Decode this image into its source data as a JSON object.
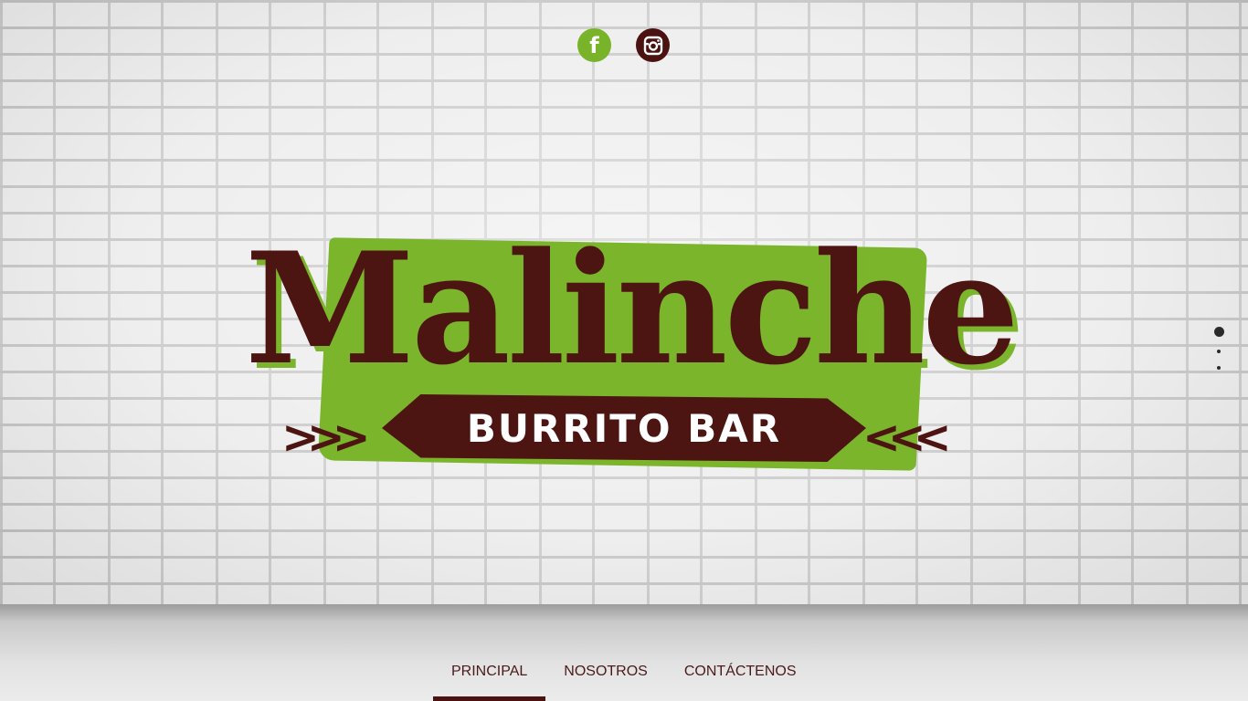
{
  "social": [
    {
      "name": "facebook",
      "icon": "facebook-icon",
      "glyph": "f",
      "color": "#78b32a"
    },
    {
      "name": "instagram",
      "icon": "instagram-icon",
      "color": "#4a1210"
    }
  ],
  "logo": {
    "title": "Malinche",
    "subtitle": "BURRITO BAR",
    "colors": {
      "brown": "#4d1512",
      "green": "#7ab52b",
      "white": "#ffffff"
    }
  },
  "slider": {
    "dots": 3,
    "active_index": 0
  },
  "nav": {
    "items": [
      {
        "label": "PRINCIPAL",
        "active": true
      },
      {
        "label": "NOSOTROS",
        "active": false
      },
      {
        "label": "CONTÁCTENOS",
        "active": false
      }
    ]
  }
}
